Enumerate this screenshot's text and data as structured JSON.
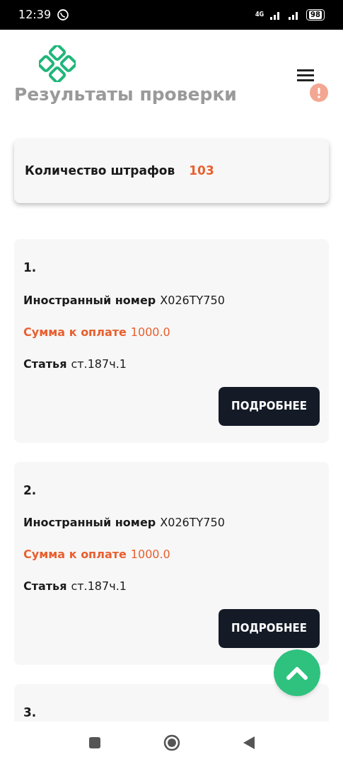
{
  "status_bar": {
    "time": "12:39",
    "network": "4G",
    "battery": "98"
  },
  "header": {
    "title": "Результаты проверки"
  },
  "summary": {
    "label": "Количество штрафов",
    "value": "103"
  },
  "fines": [
    {
      "number": "1.",
      "plate_label": "Иностранный номер",
      "plate": "X026TY750",
      "amount_label": "Сумма к оплате",
      "amount": "1000.0",
      "article_label": "Статья",
      "article": "ст.187ч.1",
      "button": "ПОДРОБНЕЕ"
    },
    {
      "number": "2.",
      "plate_label": "Иностранный номер",
      "plate": "X026TY750",
      "amount_label": "Сумма к оплате",
      "amount": "1000.0",
      "article_label": "Статья",
      "article": "ст.187ч.1",
      "button": "ПОДРОБНЕЕ"
    },
    {
      "number": "3."
    }
  ]
}
